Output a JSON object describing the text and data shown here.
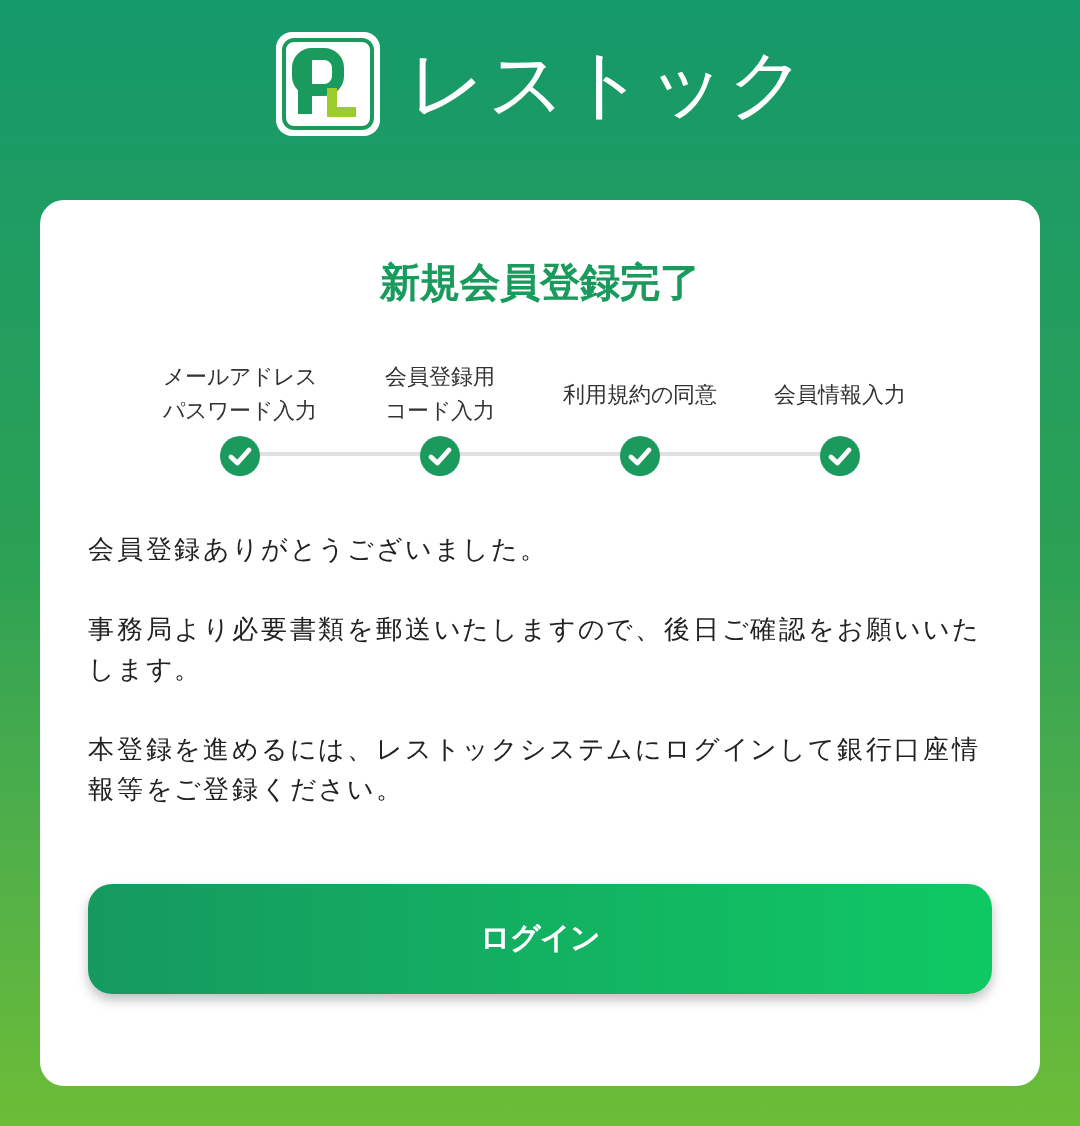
{
  "header": {
    "logo_text": "レストック"
  },
  "card": {
    "title": "新規会員登録完了",
    "steps": [
      {
        "label_lines": [
          "メールアドレス",
          "パスワード入力"
        ],
        "done": true
      },
      {
        "label_lines": [
          "会員登録用",
          "コード入力"
        ],
        "done": true
      },
      {
        "label_lines": [
          "利用規約の同意"
        ],
        "done": true
      },
      {
        "label_lines": [
          "会員情報入力"
        ],
        "done": true
      }
    ],
    "paragraphs": [
      "会員登録ありがとうございました。",
      "事務局より必要書類を郵送いたしますので、後日ご確認をお願いいたします。",
      "本登録を進めるには、レストックシステムにログインして銀行口座情報等をご登録ください。"
    ],
    "button": "ログイン"
  }
}
